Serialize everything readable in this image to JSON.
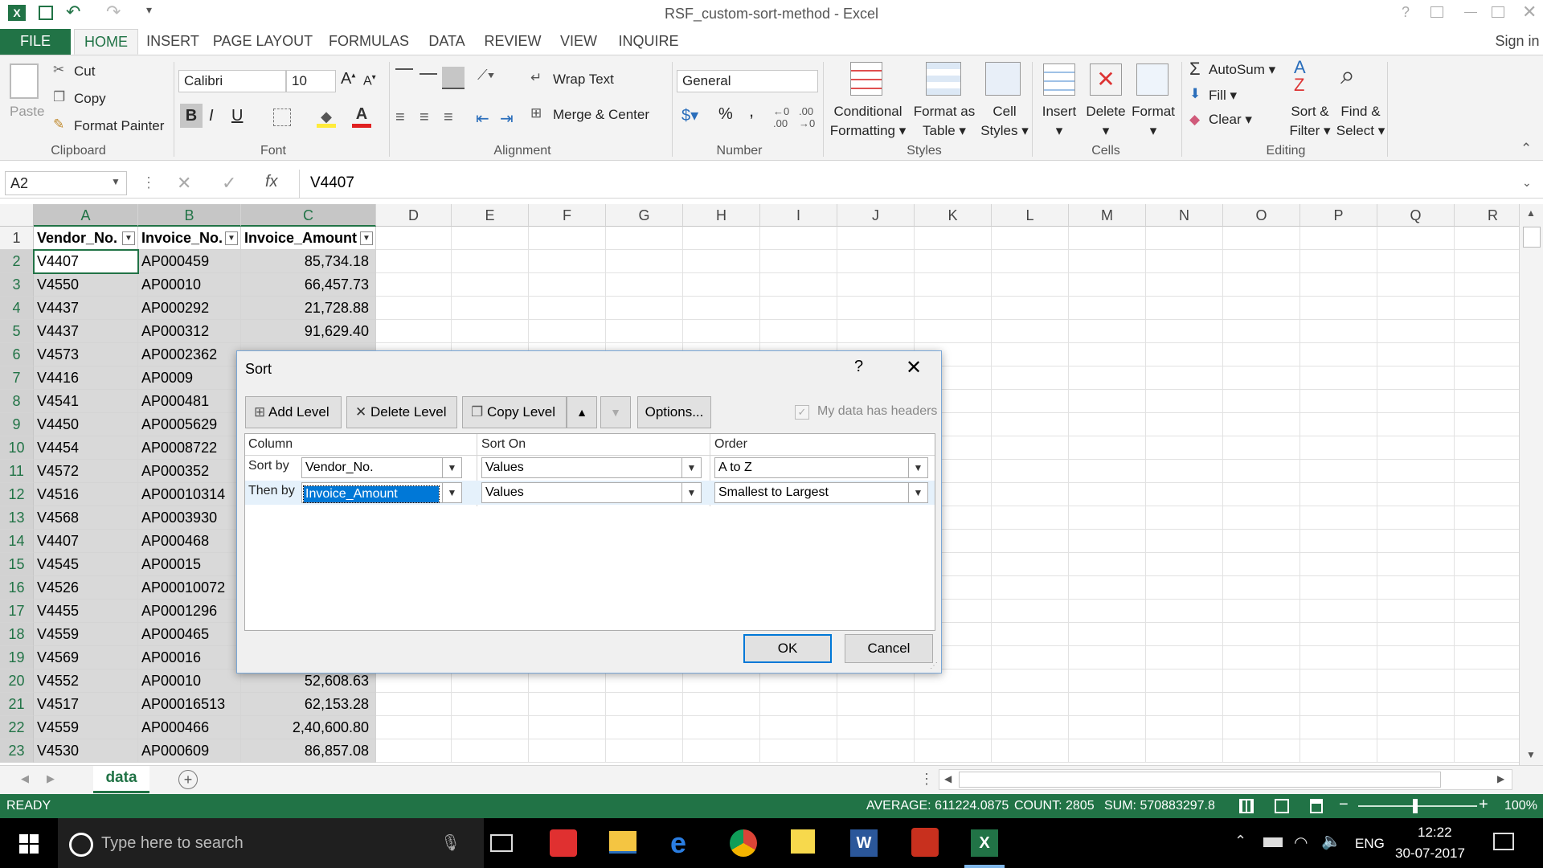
{
  "window": {
    "title": "RSF_custom-sort-method - Excel",
    "help": "?",
    "signin": "Sign in"
  },
  "tabs": [
    "FILE",
    "HOME",
    "INSERT",
    "PAGE LAYOUT",
    "FORMULAS",
    "DATA",
    "REVIEW",
    "VIEW",
    "INQUIRE"
  ],
  "ribbon": {
    "clipboard": {
      "paste": "Paste",
      "cut": "Cut",
      "copy": "Copy",
      "format_painter": "Format Painter",
      "group": "Clipboard"
    },
    "font": {
      "name": "Calibri",
      "size": "10",
      "bold": "B",
      "italic": "I",
      "underline": "U",
      "group": "Font"
    },
    "alignment": {
      "wrap": "Wrap Text",
      "merge": "Merge & Center",
      "group": "Alignment"
    },
    "number": {
      "format": "General",
      "percent": "%",
      "comma": ",",
      "group": "Number"
    },
    "styles": {
      "cond1": "Conditional",
      "cond2": "Formatting",
      "fmt1": "Format as",
      "fmt2": "Table",
      "cell1": "Cell",
      "cell2": "Styles",
      "group": "Styles"
    },
    "cells": {
      "insert": "Insert",
      "delete": "Delete",
      "format": "Format",
      "group": "Cells"
    },
    "editing": {
      "autosum": "AutoSum",
      "fill": "Fill",
      "clear": "Clear",
      "sort1": "Sort &",
      "sort2": "Filter",
      "find1": "Find &",
      "find2": "Select",
      "group": "Editing"
    }
  },
  "formula_bar": {
    "name_box": "A2",
    "fx": "fx",
    "value": "V4407"
  },
  "columns": [
    "A",
    "B",
    "C",
    "D",
    "E",
    "F",
    "G",
    "H",
    "I",
    "J",
    "K",
    "L",
    "M",
    "N",
    "O",
    "P",
    "Q",
    "R"
  ],
  "headers": [
    "Vendor_No.",
    "Invoice_No.",
    "Invoice_Amount"
  ],
  "rows": [
    [
      "V4407",
      "AP000459",
      "85,734.18"
    ],
    [
      "V4550",
      "AP00010",
      "66,457.73"
    ],
    [
      "V4437",
      "AP000292",
      "21,728.88"
    ],
    [
      "V4437",
      "AP000312",
      "91,629.40"
    ],
    [
      "V4573",
      "AP0002362",
      ""
    ],
    [
      "V4416",
      "AP0009",
      ""
    ],
    [
      "V4541",
      "AP000481",
      ""
    ],
    [
      "V4450",
      "AP0005629",
      ""
    ],
    [
      "V4454",
      "AP0008722",
      ""
    ],
    [
      "V4572",
      "AP000352",
      ""
    ],
    [
      "V4516",
      "AP00010314",
      ""
    ],
    [
      "V4568",
      "AP0003930",
      ""
    ],
    [
      "V4407",
      "AP000468",
      ""
    ],
    [
      "V4545",
      "AP00015",
      ""
    ],
    [
      "V4526",
      "AP00010072",
      ""
    ],
    [
      "V4455",
      "AP0001296",
      ""
    ],
    [
      "V4559",
      "AP000465",
      ""
    ],
    [
      "V4569",
      "AP00016",
      ""
    ],
    [
      "V4552",
      "AP00010",
      "52,608.63"
    ],
    [
      "V4517",
      "AP00016513",
      "62,153.28"
    ],
    [
      "V4559",
      "AP000466",
      "2,40,600.80"
    ],
    [
      "V4530",
      "AP000609",
      "86,857.08"
    ]
  ],
  "sheet_tab": "data",
  "status": {
    "ready": "READY",
    "average": "AVERAGE: 611224.0875",
    "count": "COUNT: 2805",
    "sum": "SUM: 570883297.8",
    "zoom": "100%"
  },
  "taskbar": {
    "search": "Type here to search",
    "lang": "ENG",
    "time": "12:22",
    "date": "30-07-2017"
  },
  "dialog": {
    "title": "Sort",
    "help": "?",
    "add_level": "Add Level",
    "delete_level": "Delete Level",
    "copy_level": "Copy Level",
    "options": "Options...",
    "headers_checkbox": "My data has headers",
    "col_column": "Column",
    "col_sort_on": "Sort On",
    "col_order": "Order",
    "levels": [
      {
        "label": "Sort by",
        "column": "Vendor_No.",
        "sort_on": "Values",
        "order": "A to Z"
      },
      {
        "label": "Then by",
        "column": "Invoice_Amount",
        "sort_on": "Values",
        "order": "Smallest to Largest"
      }
    ],
    "ok": "OK",
    "cancel": "Cancel"
  },
  "colors": {
    "excel_green": "#217346",
    "selection": "#d9d9d9",
    "dialog_bg": "#f0f0f0"
  }
}
